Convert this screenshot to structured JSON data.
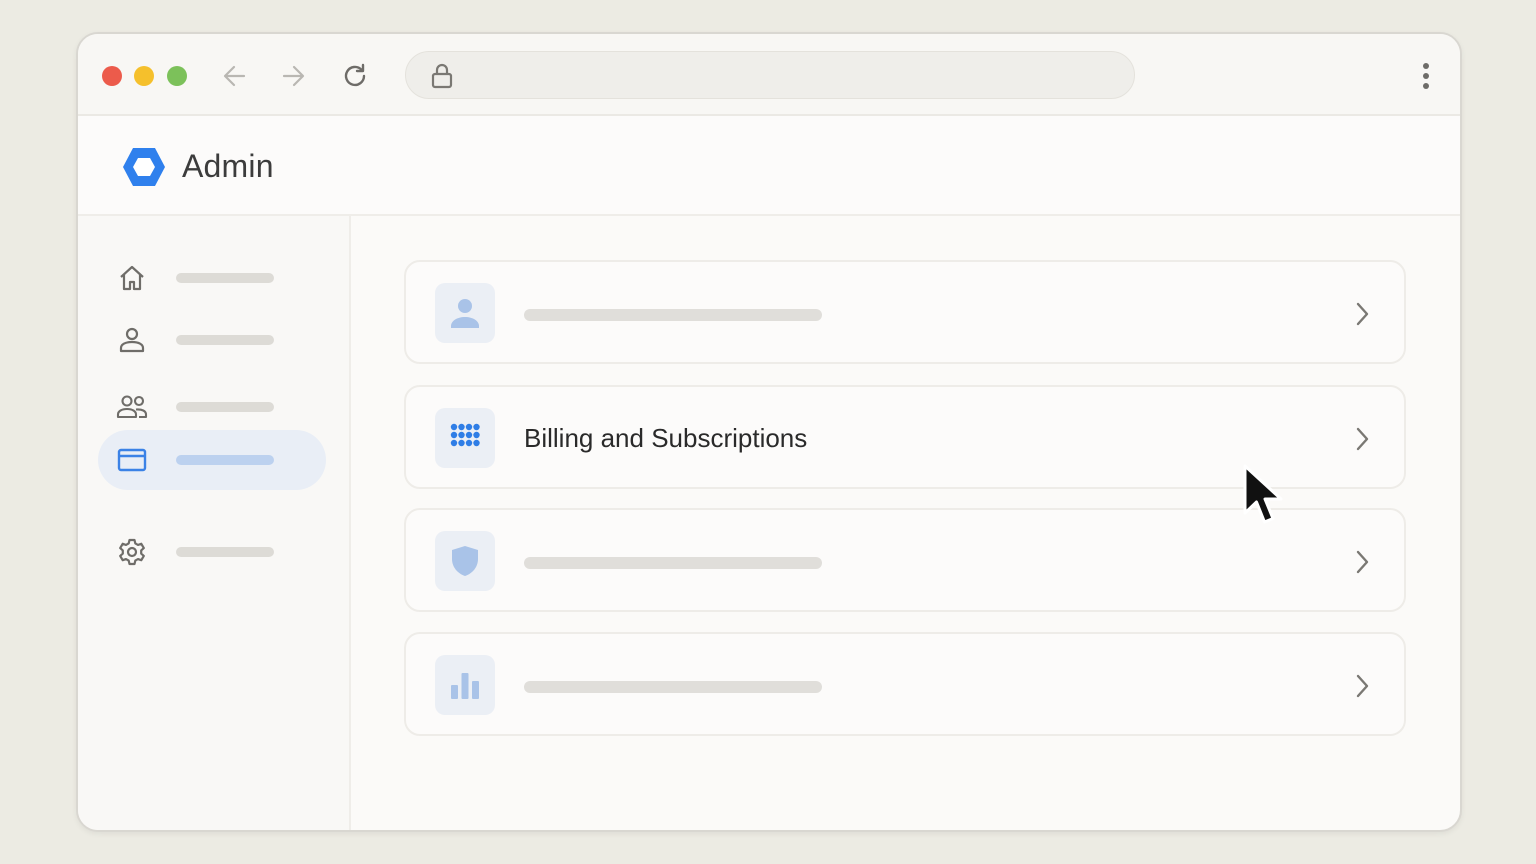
{
  "browser": {
    "url": "",
    "traffic_lights": [
      "#ec5b4b",
      "#f5c02c",
      "#7cc15a"
    ],
    "icons": {
      "back": "arrow-left-icon",
      "forward": "arrow-right-icon",
      "reload": "reload-icon",
      "lock": "lock-icon",
      "menu": "more-vertical-icon"
    }
  },
  "app": {
    "title": "Admin",
    "logo_color": "#2f80ed",
    "accent_color": "#3b82e6"
  },
  "sidebar": {
    "items": [
      {
        "icon": "home-icon",
        "label": "",
        "active": false
      },
      {
        "icon": "user-icon",
        "label": "",
        "active": false
      },
      {
        "icon": "users-icon",
        "label": "",
        "active": false
      },
      {
        "icon": "credit-card-icon",
        "label": "",
        "active": true
      },
      {
        "icon": "gear-icon",
        "label": "",
        "active": false
      }
    ]
  },
  "main": {
    "cards": [
      {
        "icon": "person-icon",
        "title": ""
      },
      {
        "icon": "apps-grid-icon",
        "title": "Billing and Subscriptions"
      },
      {
        "icon": "shield-icon",
        "title": ""
      },
      {
        "icon": "bar-chart-icon",
        "title": ""
      }
    ]
  }
}
